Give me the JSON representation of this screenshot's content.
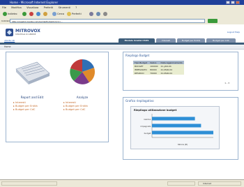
{
  "window": {
    "title": "Home - Microsoft Internet Explorer"
  },
  "menu": [
    "File",
    "Modifica",
    "Visualizza",
    "Preferiti",
    "Strumenti",
    "?"
  ],
  "toolbar": {
    "back": "Indietro",
    "search": "Cerca",
    "favorites": "Preferiti"
  },
  "address": {
    "label": "Indirizzo",
    "value": "http://mewild.manila.com/portal/PortalI/1/1/1=..."
  },
  "site": {
    "brand": "MITROVOX",
    "tagline": "STRATEGIA DI GENERE",
    "links": "Logout   Help",
    "user": "utente.nik"
  },
  "tabs": [
    {
      "label": "Modulo Analisi CSUS",
      "active": true
    },
    {
      "label": "Interesti",
      "active": false
    },
    {
      "label": "Budget per Entità",
      "active": false
    },
    {
      "label": "Budget per CdC",
      "active": false
    }
  ],
  "home": "Home",
  "cards": [
    {
      "title": "Report and Edit",
      "links": [
        "Interesti",
        "Budget per Entità",
        "Budget per CdC"
      ]
    },
    {
      "title": "Analyze",
      "links": [
        "Interesti",
        "Budget per Entità",
        "Budget per CdC"
      ]
    }
  ],
  "budget": {
    "title": "Riepilogo Budget",
    "columns": [
      "Tipo Budget",
      "Valore",
      "Data Aggiornamento"
    ],
    "rows": [
      [
        "BUDGET",
        "100000",
        "21-JAN-04"
      ],
      [
        "IMPEGNATO",
        "80000",
        "21-MAR-04"
      ],
      [
        "RESIDUO",
        "70000",
        "21-MAR-04"
      ]
    ],
    "pager": "1 - 3"
  },
  "graph": {
    "panel_title": "Grafico riepilogativo",
    "chart_data": {
      "type": "bar",
      "orientation": "horizontal",
      "title": "Riepilogo utilizzazione budget",
      "categories": [
        "residuo",
        "impegnato",
        "budget"
      ],
      "values": [
        70000,
        80000,
        100000
      ],
      "xlabel": "Valore (€)",
      "xlim": [
        0,
        100000
      ],
      "bar_color": "#2e8fd6"
    }
  },
  "status": {
    "zone": "Internet"
  },
  "colors": {
    "accent": "#3d5d7a",
    "link": "#c46a2a",
    "titlebar": "#1f3f9a"
  }
}
